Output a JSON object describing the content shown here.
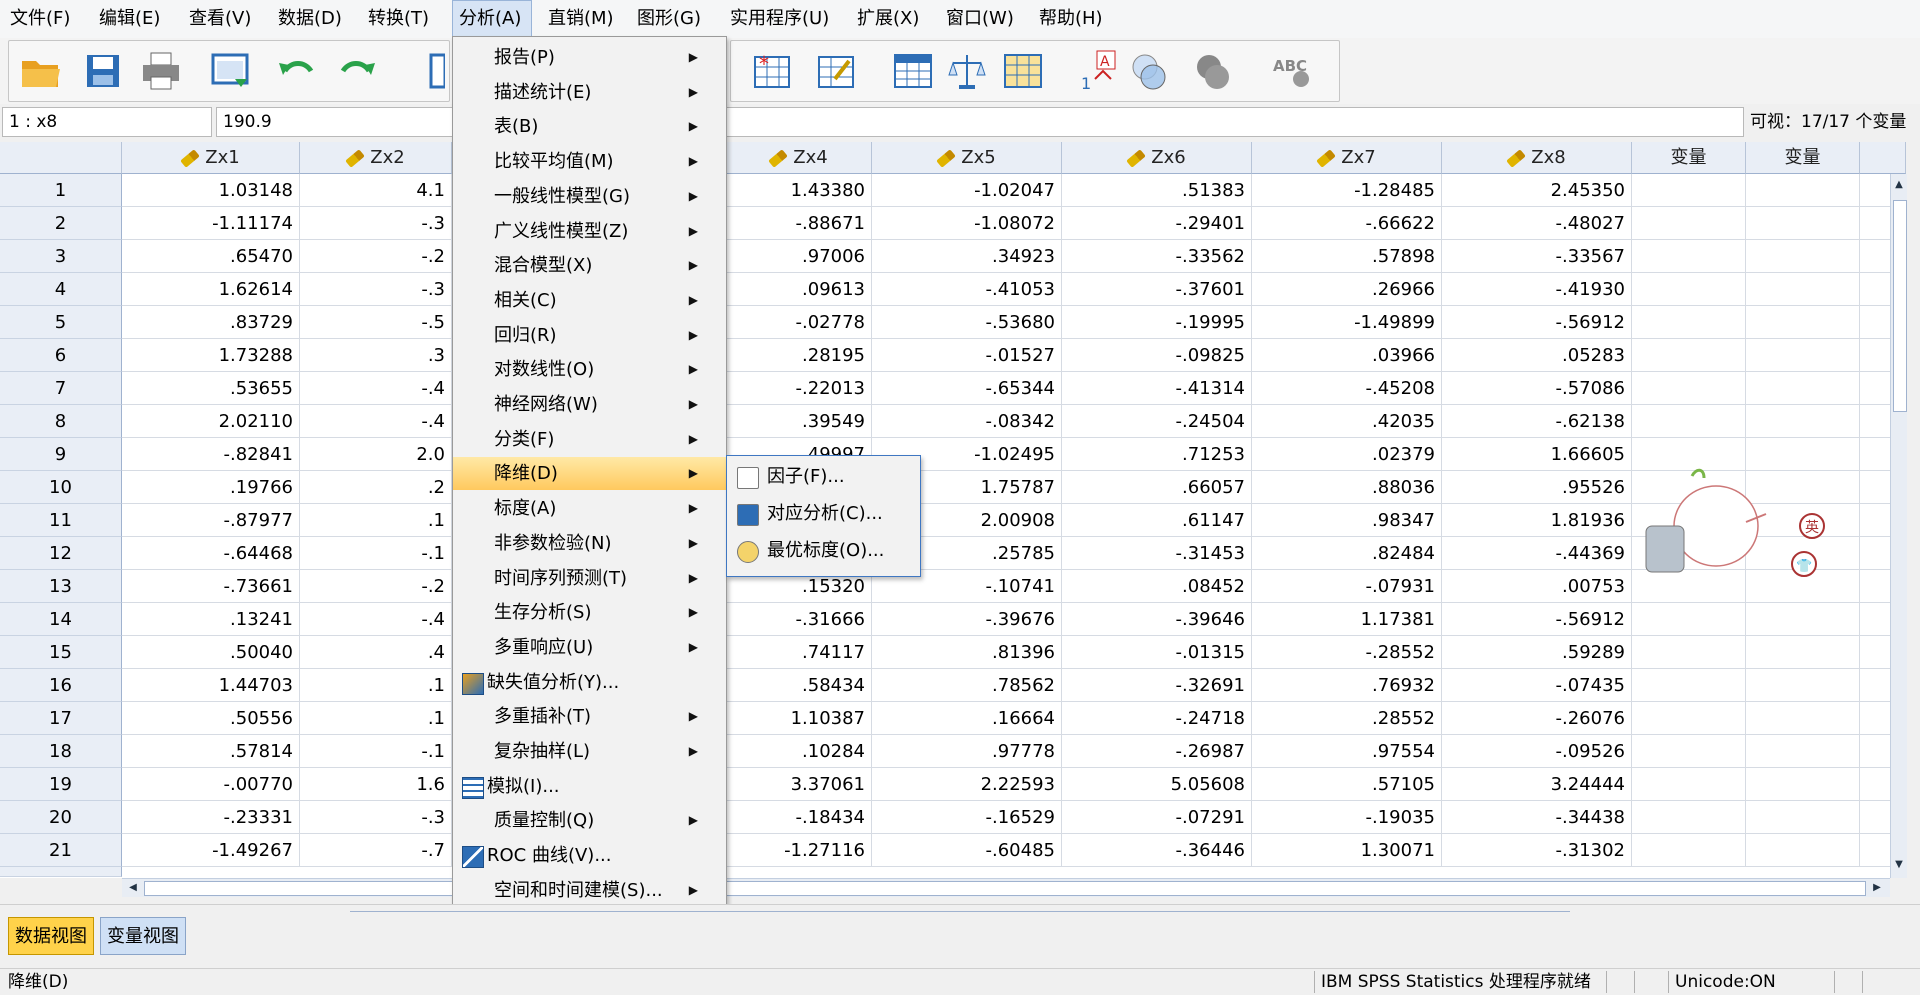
{
  "menubar": {
    "items": [
      {
        "label": "文件(F)"
      },
      {
        "label": "编辑(E)"
      },
      {
        "label": "查看(V)"
      },
      {
        "label": "数据(D)"
      },
      {
        "label": "转换(T)"
      },
      {
        "label": "分析(A)"
      },
      {
        "label": "直销(M)"
      },
      {
        "label": "图形(G)"
      },
      {
        "label": "实用程序(U)"
      },
      {
        "label": "扩展(X)"
      },
      {
        "label": "窗口(W)"
      },
      {
        "label": "帮助(H)"
      }
    ]
  },
  "editor": {
    "cell_ref": "1 : x8",
    "cell_value": "190.9",
    "visible_vars": "可视：17/17 个变量"
  },
  "grid": {
    "columns": [
      "Zx1",
      "Zx2",
      "Zx4",
      "Zx5",
      "Zx6",
      "Zx7",
      "Zx8",
      "变量",
      "变量"
    ],
    "rows": [
      {
        "n": "1",
        "zx1": "1.03148",
        "zx2": "4.1",
        "zx4": "1.43380",
        "zx5": "-1.02047",
        "zx6": ".51383",
        "zx7": "-1.28485",
        "zx8": "2.45350"
      },
      {
        "n": "2",
        "zx1": "-1.11174",
        "zx2": "-.3",
        "zx4": "-.88671",
        "zx5": "-1.08072",
        "zx6": "-.29401",
        "zx7": "-.66622",
        "zx8": "-.48027"
      },
      {
        "n": "3",
        "zx1": ".65470",
        "zx2": "-.2",
        "zx4": ".97006",
        "zx5": ".34923",
        "zx6": "-.33562",
        "zx7": ".57898",
        "zx8": "-.33567"
      },
      {
        "n": "4",
        "zx1": "1.62614",
        "zx2": "-.3",
        "zx4": ".09613",
        "zx5": "-.41053",
        "zx6": "-.37601",
        "zx7": ".26966",
        "zx8": "-.41930"
      },
      {
        "n": "5",
        "zx1": ".83729",
        "zx2": "-.5",
        "zx4": "-.02778",
        "zx5": "-.53680",
        "zx6": "-.19995",
        "zx7": "-1.49899",
        "zx8": "-.56912"
      },
      {
        "n": "6",
        "zx1": "1.73288",
        "zx2": ".3",
        "zx4": ".28195",
        "zx5": "-.01527",
        "zx6": "-.09825",
        "zx7": ".03966",
        "zx8": ".05283"
      },
      {
        "n": "7",
        "zx1": ".53655",
        "zx2": "-.4",
        "zx4": "-.22013",
        "zx5": "-.65344",
        "zx6": "-.41314",
        "zx7": "-.45208",
        "zx8": "-.57086"
      },
      {
        "n": "8",
        "zx1": "2.02110",
        "zx2": "-.4",
        "zx4": ".39549",
        "zx5": "-.08342",
        "zx6": "-.24504",
        "zx7": ".42035",
        "zx8": "-.62138"
      },
      {
        "n": "9",
        "zx1": "-.82841",
        "zx2": "2.0",
        "zx4": ".49997",
        "zx5": "-1.02495",
        "zx6": ".71253",
        "zx7": ".02379",
        "zx8": "1.66605"
      },
      {
        "n": "10",
        "zx1": ".19766",
        "zx2": ".2",
        "zx4": "",
        "zx5": "1.75787",
        "zx6": ".66057",
        "zx7": ".88036",
        "zx8": ".95526"
      },
      {
        "n": "11",
        "zx1": "-.87977",
        "zx2": ".1",
        "zx4": "",
        "zx5": "2.00908",
        "zx6": ".61147",
        "zx7": ".98347",
        "zx8": "1.81936"
      },
      {
        "n": "12",
        "zx1": "-.64468",
        "zx2": "-.1",
        "zx4": "",
        "zx5": ".25785",
        "zx6": "-.31453",
        "zx7": ".82484",
        "zx8": "-.44369"
      },
      {
        "n": "13",
        "zx1": "-.73661",
        "zx2": "-.2",
        "zx4": ".15320",
        "zx5": "-.10741",
        "zx6": ".08452",
        "zx7": "-.07931",
        "zx8": ".00753"
      },
      {
        "n": "14",
        "zx1": ".13241",
        "zx2": "-.4",
        "zx4": "-.31666",
        "zx5": "-.39676",
        "zx6": "-.39646",
        "zx7": "1.17381",
        "zx8": "-.56912"
      },
      {
        "n": "15",
        "zx1": ".50040",
        "zx2": ".4",
        "zx4": ".74117",
        "zx5": ".81396",
        "zx6": "-.01315",
        "zx7": "-.28552",
        "zx8": ".59289"
      },
      {
        "n": "16",
        "zx1": "1.44703",
        "zx2": ".1",
        "zx4": ".58434",
        "zx5": ".78562",
        "zx6": "-.32691",
        "zx7": ".76932",
        "zx8": "-.07435"
      },
      {
        "n": "17",
        "zx1": ".50556",
        "zx2": ".1",
        "zx4": "1.10387",
        "zx5": ".16664",
        "zx6": "-.24718",
        "zx7": ".28552",
        "zx8": "-.26076"
      },
      {
        "n": "18",
        "zx1": ".57814",
        "zx2": "-.1",
        "zx4": ".10284",
        "zx5": ".97778",
        "zx6": "-.26987",
        "zx7": ".97554",
        "zx8": "-.09526"
      },
      {
        "n": "19",
        "zx1": "-.00770",
        "zx2": "1.6",
        "zx4": "3.37061",
        "zx5": "2.22593",
        "zx6": "5.05608",
        "zx7": ".57105",
        "zx8": "3.24444"
      },
      {
        "n": "20",
        "zx1": "-.23331",
        "zx2": "-.3",
        "zx4": "-.18434",
        "zx5": "-.16529",
        "zx6": "-.07291",
        "zx7": "-.19035",
        "zx8": "-.34438"
      },
      {
        "n": "21",
        "zx1": "-1.49267",
        "zx2": "-.7",
        "zx4": "-1.27116",
        "zx5": "-.60485",
        "zx6": "-.36446",
        "zx7": "1.30071",
        "zx8": "-.31302"
      }
    ]
  },
  "analyze_menu": {
    "items": [
      {
        "label": "报告(P)",
        "sub": true
      },
      {
        "label": "描述统计(E)",
        "sub": true
      },
      {
        "label": "表(B)",
        "sub": true
      },
      {
        "label": "比较平均值(M)",
        "sub": true
      },
      {
        "label": "一般线性模型(G)",
        "sub": true
      },
      {
        "label": "广义线性模型(Z)",
        "sub": true
      },
      {
        "label": "混合模型(X)",
        "sub": true
      },
      {
        "label": "相关(C)",
        "sub": true
      },
      {
        "label": "回归(R)",
        "sub": true
      },
      {
        "label": "对数线性(O)",
        "sub": true
      },
      {
        "label": "神经网络(W)",
        "sub": true
      },
      {
        "label": "分类(F)",
        "sub": true
      },
      {
        "label": "降维(D)",
        "sub": true,
        "highlight": true
      },
      {
        "label": "标度(A)",
        "sub": true
      },
      {
        "label": "非参数检验(N)",
        "sub": true
      },
      {
        "label": "时间序列预测(T)",
        "sub": true
      },
      {
        "label": "生存分析(S)",
        "sub": true
      },
      {
        "label": "多重响应(U)",
        "sub": true
      },
      {
        "label": "缺失值分析(Y)...",
        "icon": "missing-values-icon"
      },
      {
        "label": "多重插补(T)",
        "sub": true
      },
      {
        "label": "复杂抽样(L)",
        "sub": true
      },
      {
        "label": "模拟(I)...",
        "icon": "simulation-icon"
      },
      {
        "label": "质量控制(Q)",
        "sub": true
      },
      {
        "label": "ROC 曲线(V)...",
        "icon": "roc-curve-icon"
      },
      {
        "label": "空间和时间建模(S)...",
        "sub": true
      }
    ]
  },
  "dim_reduction_submenu": {
    "items": [
      {
        "label": "因子(F)...",
        "icon": "factor-icon"
      },
      {
        "label": "对应分析(C)...",
        "icon": "correspondence-icon"
      },
      {
        "label": "最优标度(O)...",
        "icon": "optimal-scaling-icon"
      }
    ]
  },
  "tabs": {
    "data_view": "数据视图",
    "variable_view": "变量视图"
  },
  "status": {
    "left": "降维(D)",
    "processor": "IBM SPSS Statistics 处理程序就绪",
    "unicode": "Unicode:ON"
  },
  "mascot": {
    "badge1": "英",
    "badge2": "👕"
  }
}
